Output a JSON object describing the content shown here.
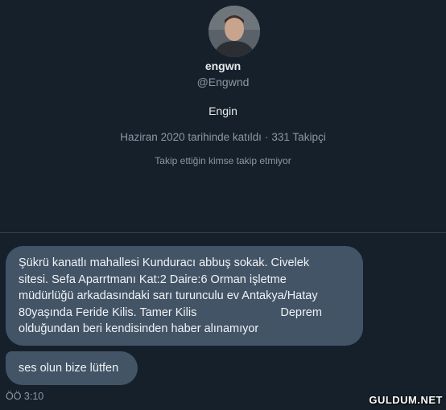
{
  "profile": {
    "display_name": "engwn",
    "handle": "@Engwnd",
    "bio": "Engin",
    "joined": "Haziran 2020 tarihinde katıldı",
    "separator": "·",
    "followers": "331 Takipçi",
    "follow_note": "Takip ettiğin kimse takip etmiyor"
  },
  "messages": [
    {
      "lines": [
        "Şükrü kanatlı mahallesi Kunduracı abbuş sokak. Civelek",
        "sitesi. Sefa Aparrtmanı Kat:2 Daire:6 Orman işletme",
        "müdürlüğü arkadasındaki sarı turunculu ev Antakya/Hatay"
      ],
      "line4_left": "80yaşında Feride Kilis. Tamer Kilis",
      "line4_right": "Deprem",
      "line5": "olduğundan beri kendisinden haber alınamıyor"
    },
    {
      "text": "ses olun bize lütfen"
    }
  ],
  "timestamp": "ÖÖ 3:10",
  "watermark": "GULDUM.NET",
  "colors": {
    "background": "#15202b",
    "bubble": "#425466",
    "muted_text": "#8b98a5"
  }
}
